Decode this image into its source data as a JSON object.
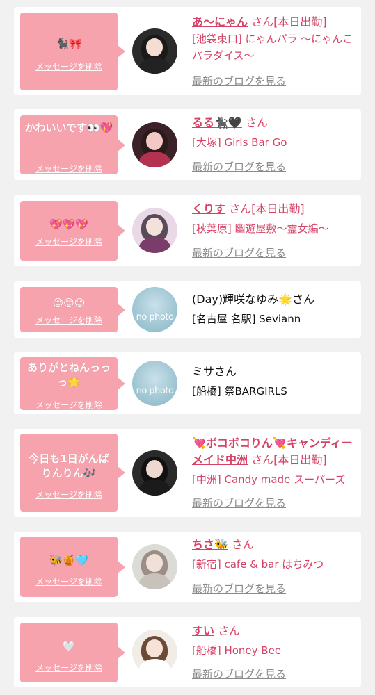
{
  "delete_label": "メッセージを削除",
  "blog_label": "最新のブログを見る",
  "entries": [
    {
      "message": "🐈‍⬛🎀",
      "name": "あ〜にゃん",
      "san": "さん",
      "status": "[本日出勤]",
      "shop": "[池袋東口] にゃんパラ 〜にゃんこパラダイス〜",
      "blog": true,
      "avatar": "photo"
    },
    {
      "message": "かわいいです👀💖",
      "name": "るる🐈‍⬛🖤",
      "san": "さん",
      "status": "",
      "shop": "[大塚] Girls Bar Go",
      "blog": true,
      "avatar": "photo"
    },
    {
      "message": "💖💖💖",
      "name": "くりす",
      "san": "さん",
      "status": "[本日出勤]",
      "shop": "[秋葉原] 幽遊屋敷〜霊女編〜",
      "blog": true,
      "avatar": "photo"
    },
    {
      "message": "😌😌😌",
      "name": "(Day)輝咲なゆみ🌟",
      "san": "さん",
      "status": "",
      "shop": "[名古屋 名駅] Seviann",
      "blog": false,
      "avatar": "no photo"
    },
    {
      "message": "ありがとねんっっっ🌟",
      "name": "ミサ",
      "san": "さん",
      "status": "",
      "shop": "[船橋] 祭BARGIRLS",
      "blog": false,
      "avatar": "no photo"
    },
    {
      "message": "今日も1日がんばりんりん🎶",
      "name": "💘ボコボコりん💘キャンディーメイド中洲",
      "san": "さん",
      "status": "[本日出勤]",
      "shop": "[中洲] Candy made スーパーズ",
      "blog": true,
      "avatar": "photo"
    },
    {
      "message": "🐝🍯🩵",
      "name": "ちさ🐝",
      "san": "さん",
      "status": "",
      "shop": "[新宿] cafe & bar はちみつ",
      "blog": true,
      "avatar": "photo"
    },
    {
      "message": "🤍",
      "name": "すい",
      "san": "さん",
      "status": "",
      "shop": "[船橋] Honey Bee",
      "blog": true,
      "avatar": "photo"
    }
  ]
}
